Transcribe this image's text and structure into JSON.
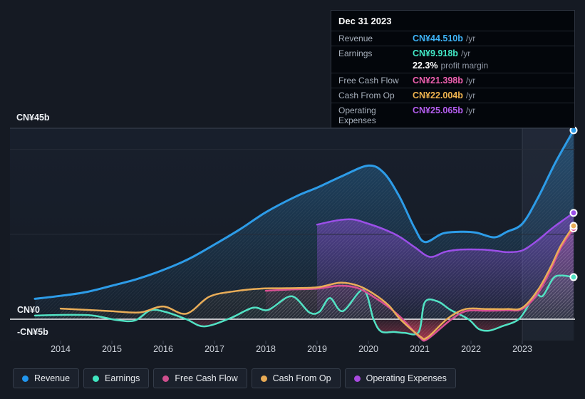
{
  "page": {
    "background": "#151a23"
  },
  "tooltip": {
    "date": "Dec 31 2023",
    "rows": [
      {
        "label": "Revenue",
        "value": "CN¥44.510b",
        "suffix": "/yr",
        "color": "#3eb3f7"
      },
      {
        "label": "Earnings",
        "value": "CN¥9.918b",
        "suffix": "/yr",
        "color": "#42e8c6",
        "sub": {
          "value": "22.3%",
          "label": "profit margin"
        }
      },
      {
        "label": "Free Cash Flow",
        "value": "CN¥21.398b",
        "suffix": "/yr",
        "color": "#ed5fae"
      },
      {
        "label": "Cash From Op",
        "value": "CN¥22.004b",
        "suffix": "/yr",
        "color": "#efb34f"
      },
      {
        "label": "Operating Expenses",
        "value": "CN¥25.065b",
        "suffix": "/yr",
        "color": "#b55ef0"
      }
    ]
  },
  "legend": {
    "items": [
      {
        "label": "Revenue",
        "color": "#2196ef"
      },
      {
        "label": "Earnings",
        "color": "#40e5c0"
      },
      {
        "label": "Free Cash Flow",
        "color": "#cf4f8e"
      },
      {
        "label": "Cash From Op",
        "color": "#e8ab55"
      },
      {
        "label": "Operating Expenses",
        "color": "#a94ae0"
      }
    ]
  },
  "chart_data": {
    "type": "area",
    "title": "Financial history: revenue, earnings, cash flow and operating expenses (CN¥ billions)",
    "x_axis": {
      "tick_years": [
        2014,
        2015,
        2016,
        2017,
        2018,
        2019,
        2020,
        2021,
        2022,
        2023
      ],
      "start": 2013.5,
      "end": 2024
    },
    "y_axis": {
      "max": 45,
      "min": -5,
      "unit": "CN¥b",
      "labels": [
        {
          "text": "CN¥45b",
          "value": 45
        },
        {
          "text": "CN¥0",
          "value": 0
        },
        {
          "text": "-CN¥5b",
          "value": -5
        }
      ],
      "gridline_values": [
        40,
        20
      ]
    },
    "highlight_band": {
      "start": 2023,
      "end": 2024
    },
    "negative_fill_color": "#e0405e",
    "series": [
      {
        "name": "Revenue",
        "color": "#2d9ce8",
        "fill_alpha": 0.32,
        "line_width": 3,
        "points": [
          [
            2013.5,
            4.8
          ],
          [
            2014,
            5.5
          ],
          [
            2014.5,
            6.4
          ],
          [
            2015,
            7.9
          ],
          [
            2015.5,
            9.5
          ],
          [
            2016,
            11.6
          ],
          [
            2016.5,
            14.2
          ],
          [
            2017,
            17.6
          ],
          [
            2017.5,
            21.2
          ],
          [
            2018,
            25.2
          ],
          [
            2018.6,
            29
          ],
          [
            2019,
            31
          ],
          [
            2019.5,
            33.8
          ],
          [
            2020,
            36.2
          ],
          [
            2020.3,
            34.5
          ],
          [
            2020.6,
            29
          ],
          [
            2020.9,
            21.5
          ],
          [
            2021.1,
            18.2
          ],
          [
            2021.45,
            20.2
          ],
          [
            2021.8,
            20.6
          ],
          [
            2022.1,
            20.4
          ],
          [
            2022.45,
            19.3
          ],
          [
            2022.7,
            20.6
          ],
          [
            2023,
            22.5
          ],
          [
            2023.3,
            28.5
          ],
          [
            2023.65,
            37
          ],
          [
            2024,
            44.51
          ]
        ]
      },
      {
        "name": "Earnings",
        "color": "#52e2c4",
        "fill_alpha": 0.28,
        "line_width": 2.5,
        "points": [
          [
            2013.5,
            0.85
          ],
          [
            2014,
            1.0
          ],
          [
            2014.6,
            0.9
          ],
          [
            2015.1,
            -0.2
          ],
          [
            2015.45,
            -0.3
          ],
          [
            2015.75,
            2.1
          ],
          [
            2016.05,
            1.7
          ],
          [
            2016.45,
            0
          ],
          [
            2016.8,
            -1.7
          ],
          [
            2017.3,
            0.2
          ],
          [
            2017.75,
            2.7
          ],
          [
            2018.05,
            2.2
          ],
          [
            2018.5,
            5.4
          ],
          [
            2018.85,
            1.6
          ],
          [
            2019.05,
            1.8
          ],
          [
            2019.25,
            5.0
          ],
          [
            2019.5,
            1.9
          ],
          [
            2019.9,
            6.9
          ],
          [
            2020.1,
            0
          ],
          [
            2020.25,
            -2.9
          ],
          [
            2020.5,
            -3.0
          ],
          [
            2020.7,
            -3.2
          ],
          [
            2020.98,
            -3.0
          ],
          [
            2021.1,
            4.0
          ],
          [
            2021.35,
            4.2
          ],
          [
            2021.6,
            2.2
          ],
          [
            2021.95,
            0
          ],
          [
            2022.15,
            -2.3
          ],
          [
            2022.35,
            -2.7
          ],
          [
            2022.6,
            -1.7
          ],
          [
            2022.93,
            0
          ],
          [
            2023.15,
            3.9
          ],
          [
            2023.27,
            5.9
          ],
          [
            2023.4,
            5.5
          ],
          [
            2023.6,
            9.6
          ],
          [
            2023.75,
            10.3
          ],
          [
            2024,
            9.918
          ]
        ]
      },
      {
        "name": "Cash From Op",
        "color": "#e9ad58",
        "fill_alpha": 0.22,
        "line_width": 2.5,
        "points": [
          [
            2014,
            2.5
          ],
          [
            2014.5,
            2.2
          ],
          [
            2015,
            1.9
          ],
          [
            2015.55,
            1.6
          ],
          [
            2016,
            3.0
          ],
          [
            2016.45,
            1.3
          ],
          [
            2016.9,
            5.3
          ],
          [
            2017.4,
            6.6
          ],
          [
            2017.9,
            7.2
          ],
          [
            2018.4,
            7.3
          ],
          [
            2019,
            7.5
          ],
          [
            2019.45,
            8.6
          ],
          [
            2019.8,
            7.9
          ],
          [
            2020.1,
            6.0
          ],
          [
            2020.4,
            3.2
          ],
          [
            2020.62,
            0
          ],
          [
            2021,
            -4.0
          ],
          [
            2021.15,
            -4.3
          ],
          [
            2021.55,
            0.2
          ],
          [
            2021.9,
            2.4
          ],
          [
            2022.3,
            2.4
          ],
          [
            2022.7,
            2.4
          ],
          [
            2023,
            2.7
          ],
          [
            2023.3,
            6.8
          ],
          [
            2023.55,
            12.2
          ],
          [
            2023.75,
            17.3
          ],
          [
            2024,
            22.004
          ]
        ]
      },
      {
        "name": "Free Cash Flow",
        "color": "#d85094",
        "fill_alpha": 0.45,
        "line_width": 2.5,
        "points": [
          [
            2018,
            6.7
          ],
          [
            2018.5,
            7.0
          ],
          [
            2019,
            7.2
          ],
          [
            2019.45,
            7.9
          ],
          [
            2019.8,
            7.3
          ],
          [
            2020.1,
            5.3
          ],
          [
            2020.4,
            2.8
          ],
          [
            2020.67,
            0
          ],
          [
            2021,
            -4.3
          ],
          [
            2021.15,
            -4.7
          ],
          [
            2021.6,
            -0.2
          ],
          [
            2021.9,
            1.9
          ],
          [
            2022.3,
            2.0
          ],
          [
            2022.7,
            2.1
          ],
          [
            2023,
            2.4
          ],
          [
            2023.3,
            6.0
          ],
          [
            2023.55,
            11.5
          ],
          [
            2023.75,
            16.8
          ],
          [
            2024,
            21.398
          ]
        ]
      },
      {
        "name": "Operating Expenses",
        "color": "#9b4fe8",
        "fill_alpha": 0.8,
        "line_width": 2.5,
        "points": [
          [
            2019,
            22.3
          ],
          [
            2019.4,
            23.3
          ],
          [
            2019.7,
            23.5
          ],
          [
            2020,
            22.5
          ],
          [
            2020.3,
            21.2
          ],
          [
            2020.6,
            19.5
          ],
          [
            2020.9,
            17.0
          ],
          [
            2021.2,
            14.7
          ],
          [
            2021.5,
            15.9
          ],
          [
            2021.8,
            16.4
          ],
          [
            2022.2,
            16.4
          ],
          [
            2022.5,
            16.1
          ],
          [
            2022.7,
            15.8
          ],
          [
            2023,
            16.2
          ],
          [
            2023.3,
            18.6
          ],
          [
            2023.6,
            21.6
          ],
          [
            2024,
            25.065
          ]
        ]
      }
    ]
  }
}
